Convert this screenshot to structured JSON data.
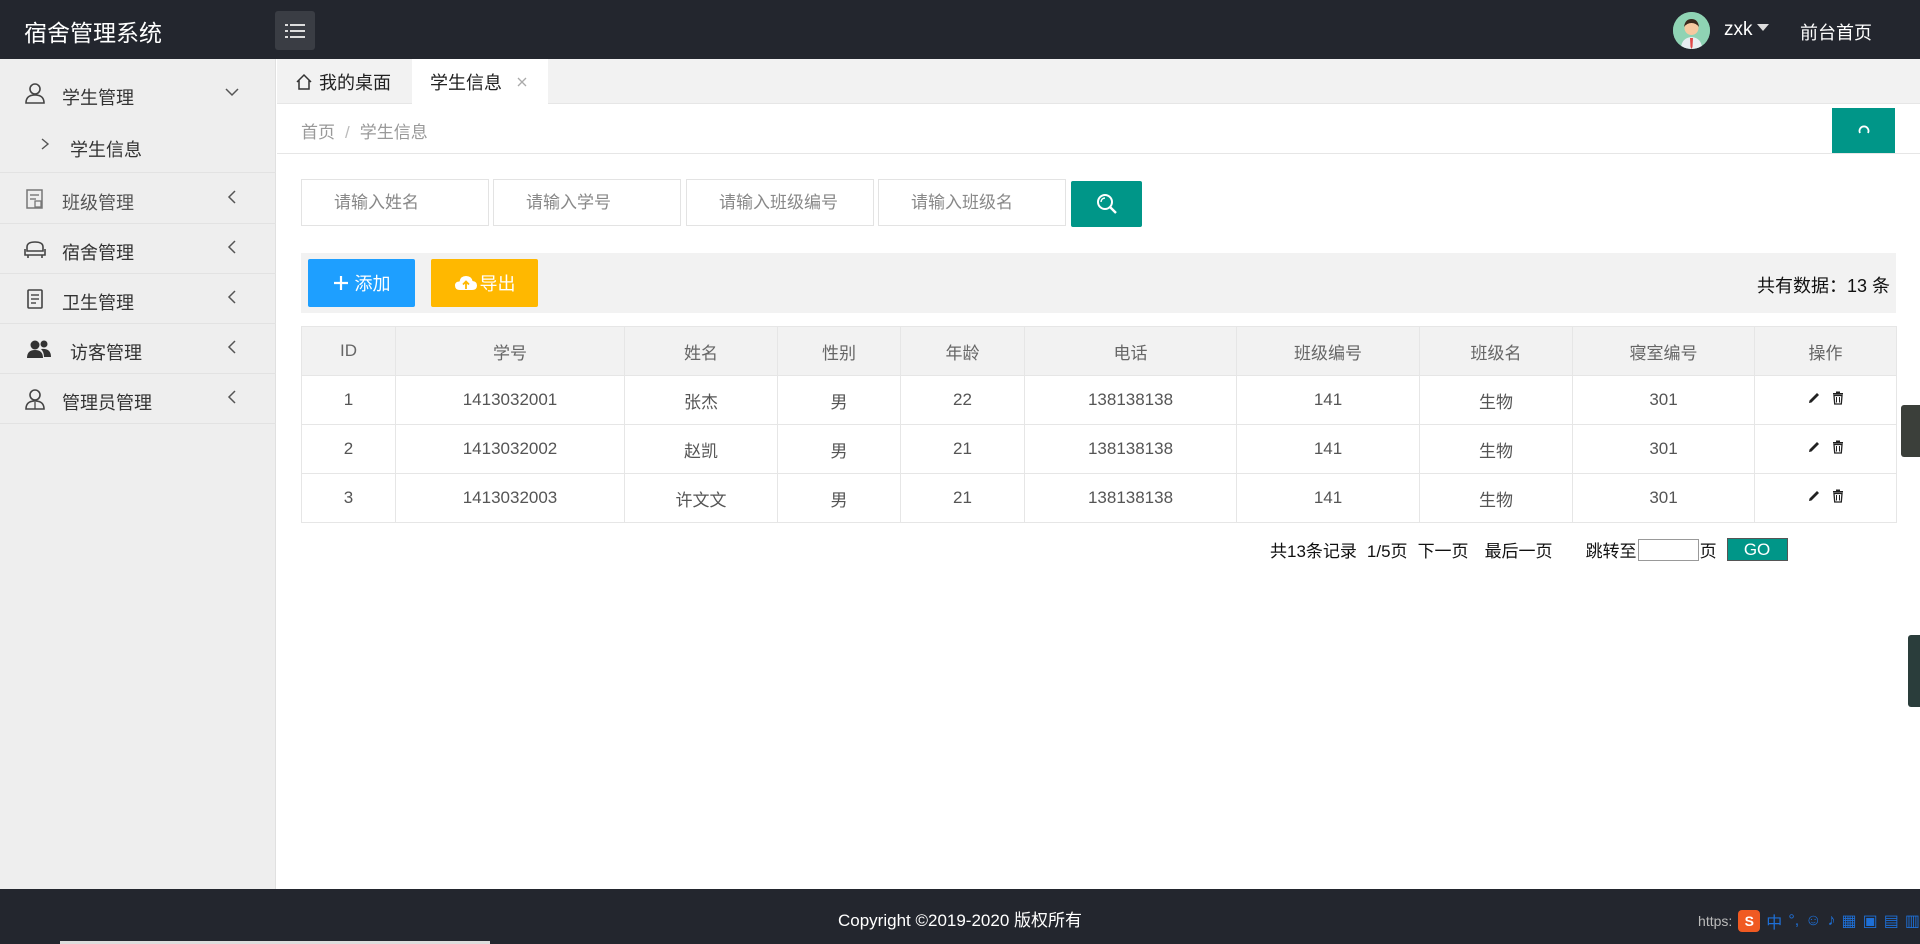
{
  "app": {
    "title": "宿舍管理系统"
  },
  "header": {
    "user_name": "zxk",
    "front_link": "前台首页"
  },
  "sidebar": {
    "items": [
      {
        "label": "学生管理"
      },
      {
        "label": "班级管理"
      },
      {
        "label": "宿舍管理"
      },
      {
        "label": "卫生管理"
      },
      {
        "label": "访客管理"
      },
      {
        "label": "管理员管理"
      }
    ],
    "sub_items": [
      {
        "label": "学生信息"
      }
    ]
  },
  "tabs": [
    {
      "label": "我的桌面"
    },
    {
      "label": "学生信息"
    }
  ],
  "breadcrumb": {
    "home": "首页",
    "separator": "/",
    "current": "学生信息"
  },
  "search": {
    "name_placeholder": "请输入姓名",
    "student_no_placeholder": "请输入学号",
    "class_no_placeholder": "请输入班级编号",
    "class_name_placeholder": "请输入班级名"
  },
  "toolbar": {
    "add_label": "添加",
    "export_label": "导出",
    "total_text": "共有数据：13 条"
  },
  "table": {
    "headers": [
      "ID",
      "学号",
      "姓名",
      "性别",
      "年龄",
      "电话",
      "班级编号",
      "班级名",
      "寝室编号",
      "操作"
    ],
    "rows": [
      [
        "1",
        "1413032001",
        "张杰",
        "男",
        "22",
        "138138138",
        "141",
        "生物",
        "301"
      ],
      [
        "2",
        "1413032002",
        "赵凯",
        "男",
        "21",
        "138138138",
        "141",
        "生物",
        "301"
      ],
      [
        "3",
        "1413032003",
        "许文文",
        "男",
        "21",
        "138138138",
        "141",
        "生物",
        "301"
      ]
    ]
  },
  "pagination": {
    "records": "共13条记录",
    "page": "1/5页",
    "next": "下一页",
    "last": "最后一页",
    "jump_to": "跳转至",
    "page_unit": "页",
    "go": "GO"
  },
  "footer": {
    "copyright": "Copyright ©2019-2020 版权所有",
    "url_fragment": "https:",
    "ime_text": "中"
  },
  "colors": {
    "header_bg": "#23262e",
    "primary": "#009688",
    "add_blue": "#1e9fff",
    "export_yellow": "#ffb800"
  }
}
